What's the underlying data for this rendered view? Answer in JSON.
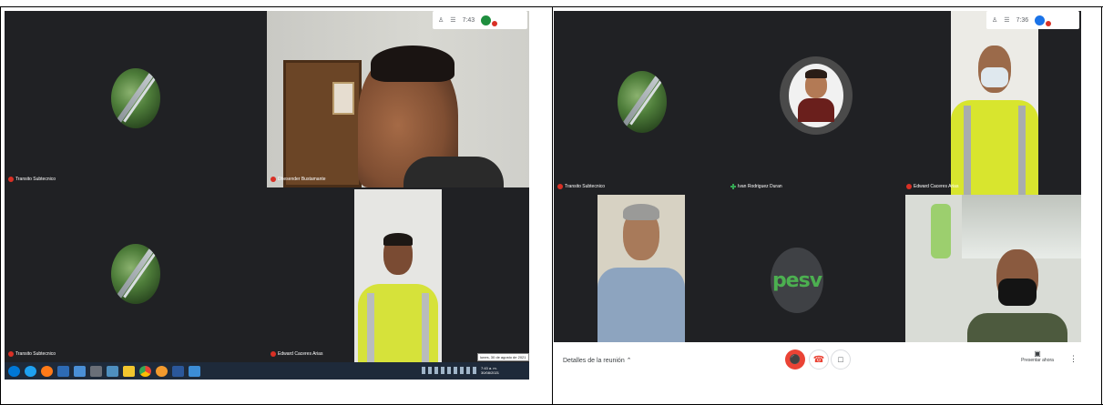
{
  "left_window": {
    "top_bar": {
      "time": "7:43",
      "count": "1"
    },
    "tiles": [
      {
        "name": "Transito Subtecnico"
      },
      {
        "name": "Dhesender Bustamante"
      },
      {
        "name": "Transito Subtecnico"
      },
      {
        "name": "Edward Caceres Arias"
      }
    ],
    "tooltip": "lunes, 30 de agosto de 2021",
    "tray_time": "7:43 a. m.",
    "tray_date": "30/08/2021"
  },
  "right_window": {
    "top_bar": {
      "time": "7:36",
      "count": "1"
    },
    "tiles": [
      {
        "name": "Transito Subtecnico"
      },
      {
        "name": "Ivan Rodriguez Duran"
      },
      {
        "name": "Edward Caceres Arias"
      }
    ],
    "pesv_logo": "pesv",
    "bottom_bar": {
      "details_label": "Detalles de la reunión",
      "present_label": "Presentar ahora"
    }
  },
  "colors": {
    "meet_bg": "#202124",
    "mic_off_red": "#d93025",
    "hangup_red": "#ea4335",
    "pesv_green": "#4caf50",
    "taskbar": "#1e2a3a"
  },
  "icons": {
    "participants": "people-icon",
    "chat": "chat-icon",
    "mic_off": "mic-off-icon",
    "hangup": "phone-hangup-icon",
    "camera": "camera-icon",
    "present": "present-screen-icon",
    "more": "more-vert-icon",
    "chevron": "chevron-up-icon"
  }
}
